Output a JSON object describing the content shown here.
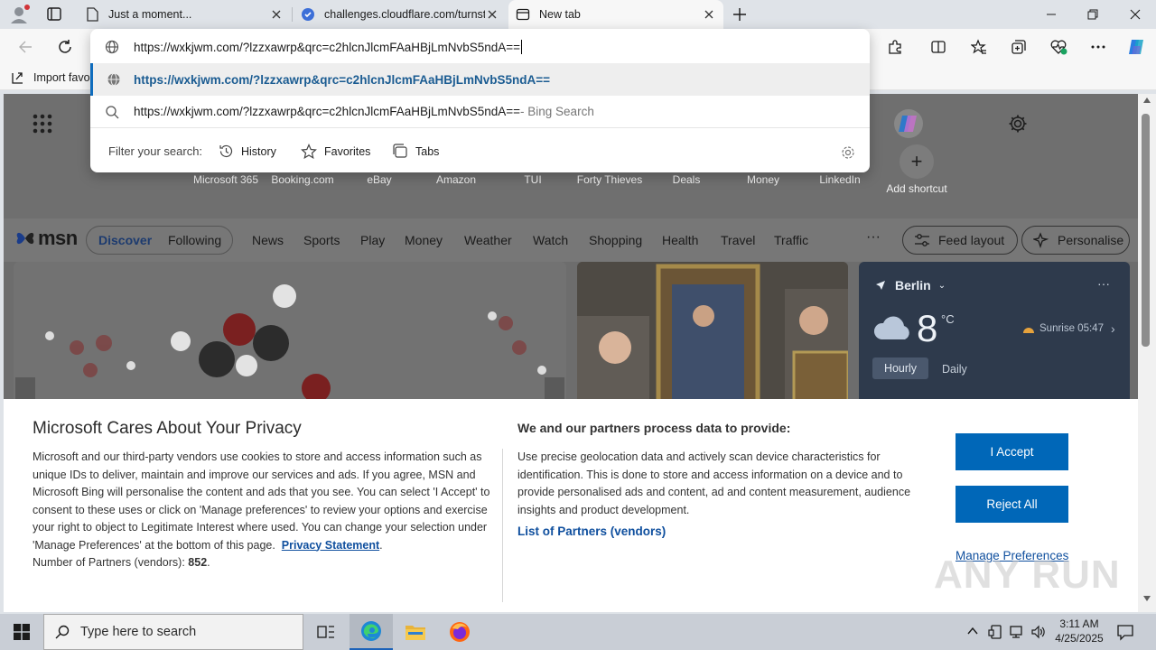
{
  "tabs": [
    {
      "title": "Just a moment...",
      "favicon": "page-icon"
    },
    {
      "title": "challenges.cloudflare.com/turnsti",
      "favicon": "cloudflare-shield-icon"
    },
    {
      "title": "New tab",
      "favicon": "newtab-icon"
    }
  ],
  "address_bar": {
    "value": "https://wxkjwm.com/?lzzxawrp&qrc=c2hlcnJlcmFAaHBjLmNvbS5ndA=="
  },
  "omnibox": {
    "suggestions": [
      {
        "text": "https://wxkjwm.com/?lzzxawrp&qrc=c2hlcnJlcmFAaHBjLmNvbS5ndA==",
        "suffix": ""
      },
      {
        "text": "https://wxkjwm.com/?lzzxawrp&qrc=c2hlcnJlcmFAaHBjLmNvbS5ndA==",
        "suffix": " - Bing Search"
      }
    ],
    "filter_label": "Filter your search:",
    "filters": [
      "History",
      "Favorites",
      "Tabs"
    ]
  },
  "favorites_bar": {
    "import_label": "Import favo"
  },
  "shortcuts": [
    {
      "label": "Microsoft 365",
      "color": "#7b5fd6"
    },
    {
      "label": "Booking.com",
      "color": "#1a3f8a"
    },
    {
      "label": "eBay",
      "color": "#e53238"
    },
    {
      "label": "Amazon",
      "color": "#ff9900"
    },
    {
      "label": "TUI",
      "color": "#4a90e2"
    },
    {
      "label": "Forty Thieves",
      "color": "#333333"
    },
    {
      "label": "Deals",
      "color": "#e85a2c"
    },
    {
      "label": "Money",
      "color": "#2d2d2d"
    },
    {
      "label": "LinkedIn",
      "color": "#0a66c2"
    },
    {
      "label": "Add shortcut",
      "color": "#888888"
    }
  ],
  "msn": {
    "logo": "msn",
    "tabs": [
      "Discover",
      "Following"
    ],
    "nav": [
      "News",
      "Sports",
      "Play",
      "Money",
      "Weather",
      "Watch",
      "Shopping",
      "Health",
      "Travel",
      "Traffic"
    ],
    "more": "···",
    "feed_layout": "Feed layout",
    "personalise": "Personalise"
  },
  "weather": {
    "city": "Berlin",
    "temp": "8",
    "unit": "°C",
    "sunrise": "Sunrise 05:47",
    "hourly": "Hourly",
    "daily": "Daily"
  },
  "privacy": {
    "title": "Microsoft Cares About Your Privacy",
    "body": "Microsoft and our third-party vendors use cookies to store and access information such as unique IDs to deliver, maintain and improve our services and ads. If you agree, MSN and Microsoft Bing will personalise the content and ads that you see. You can select 'I Accept' to consent to these uses or click on 'Manage preferences' to review your options and exercise your right to object to Legitimate Interest where used.  You can change your selection under 'Manage Preferences' at the bottom of this page.",
    "privacy_link": "Privacy Statement",
    "partners_label": "Number of Partners (vendors):",
    "partners_count": "852",
    "data_title": "We and our partners process data to provide:",
    "data_body": "Use precise geolocation data and actively scan device characteristics for identification. This is done to store and access information on a device and to provide personalised ads and content, ad and content measurement, audience insights and product development.",
    "list_link": "List of Partners (vendors)",
    "accept": "I Accept",
    "reject": "Reject All",
    "manage": "Manage Preferences"
  },
  "watermark": "ANY RUN",
  "taskbar": {
    "search_placeholder": "Type here to search",
    "time": "3:11 AM",
    "date": "4/25/2025"
  }
}
